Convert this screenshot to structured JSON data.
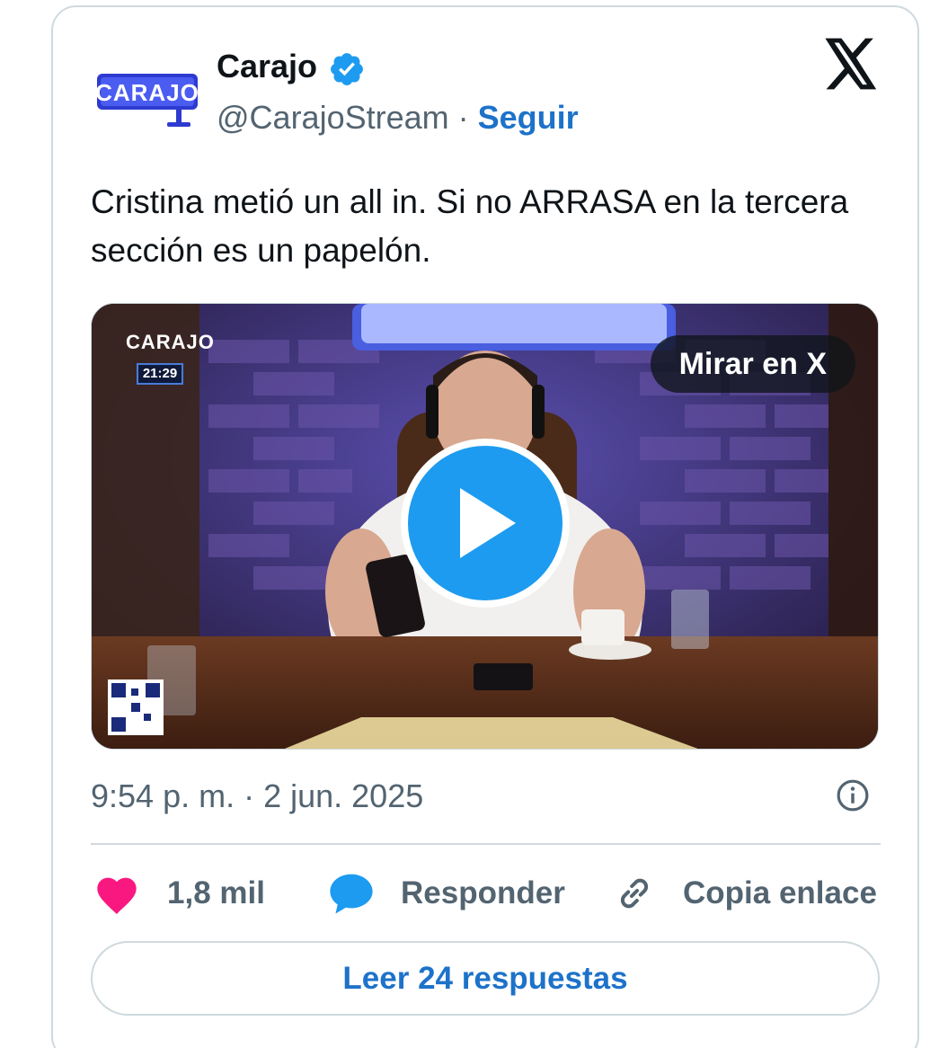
{
  "author": {
    "display_name": "Carajo",
    "handle": "@CarajoStream",
    "separator": "·",
    "follow_label": "Seguir",
    "avatar_text": "CARAJO"
  },
  "tweet": {
    "text": "Cristina metió un all in. Si no ARRASA en la tercera sección es un papelón."
  },
  "media": {
    "watch_label": "Mirar en X",
    "channel_logo": "CARAJO",
    "channel_time": "21:29"
  },
  "meta": {
    "timestamp": "9:54 p. m. · 2 jun. 2025"
  },
  "actions": {
    "like_count": "1,8 mil",
    "reply_label": "Responder",
    "copy_label": "Copia enlace"
  },
  "footer": {
    "read_replies_label": "Leer 24 respuestas"
  },
  "colors": {
    "link": "#1d72c9",
    "verified": "#1d9bf0",
    "heart": "#f91880",
    "muted": "#536471",
    "border": "#cfd9de"
  }
}
